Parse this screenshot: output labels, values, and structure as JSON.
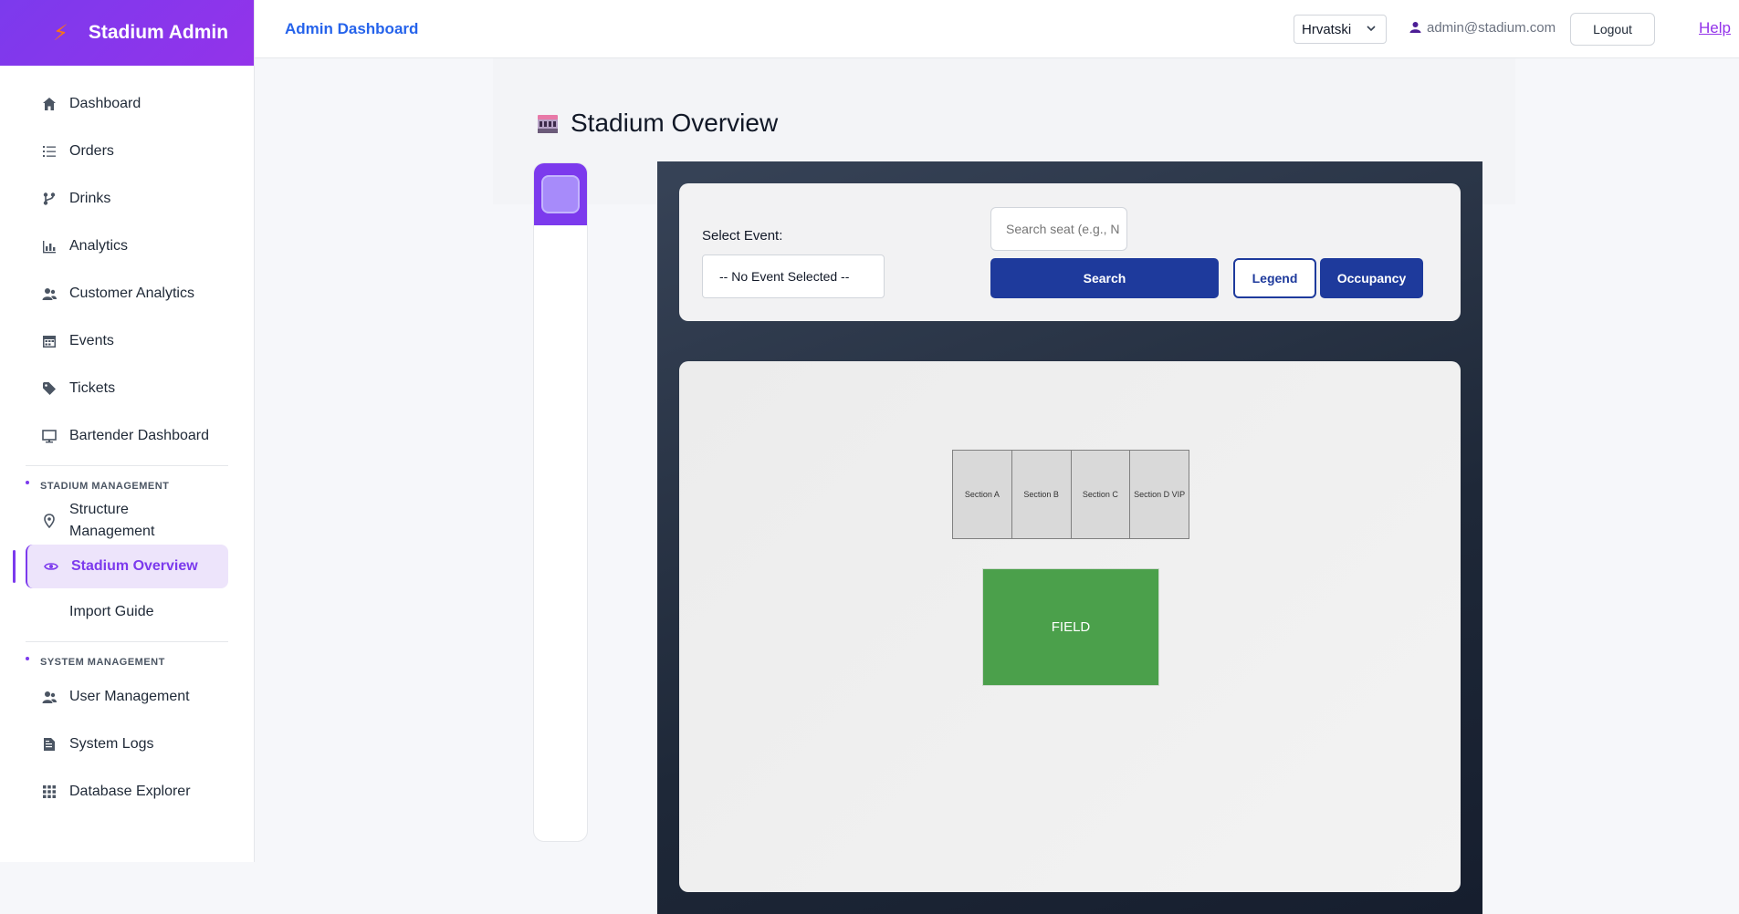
{
  "brand": {
    "title": "Stadium Admin",
    "icon": "bolt-icon"
  },
  "sidebar": {
    "items": [
      {
        "label": "Dashboard",
        "icon": "home-icon"
      },
      {
        "label": "Orders",
        "icon": "list-icon"
      },
      {
        "label": "Drinks",
        "icon": "fork-icon"
      },
      {
        "label": "Analytics",
        "icon": "bar-chart-icon"
      },
      {
        "label": "Customer Analytics",
        "icon": "users-icon"
      },
      {
        "label": "Events",
        "icon": "calendar-icon"
      },
      {
        "label": "Tickets",
        "icon": "tag-icon"
      },
      {
        "label": "Bartender Dashboard",
        "icon": "monitor-icon"
      }
    ],
    "stadium_section": {
      "header": "STADIUM MANAGEMENT",
      "items": [
        {
          "label": "Structure Management",
          "icon": "map-pin-icon"
        },
        {
          "label": "Stadium Overview",
          "icon": "eye-icon",
          "active": true
        },
        {
          "label": "Import Guide",
          "icon": ""
        }
      ]
    },
    "system_section": {
      "header": "SYSTEM MANAGEMENT",
      "items": [
        {
          "label": "User Management",
          "icon": "users-icon"
        },
        {
          "label": "System Logs",
          "icon": "log-icon"
        },
        {
          "label": "Database Explorer",
          "icon": "grid-icon"
        }
      ]
    }
  },
  "topbar": {
    "breadcrumb": "Admin Dashboard",
    "language": "Hrvatski",
    "user_email": "admin@stadium.com",
    "logout_label": "Logout",
    "help_label": "Help"
  },
  "page": {
    "title": "Stadium Overview"
  },
  "controls": {
    "select_event_label": "Select Event:",
    "selected_event": "-- No Event Selected --",
    "seat_search_placeholder": "Search seat (e.g., N",
    "search_label": "Search",
    "legend_label": "Legend",
    "occupancy_label": "Occupancy"
  },
  "map": {
    "sections": [
      "Section A",
      "Section B",
      "Section C",
      "Section D VIP"
    ],
    "field_label": "FIELD"
  },
  "colors": {
    "accent": "#7c3aed",
    "primary_button": "#1e3a9c",
    "field": "#4ba04b",
    "breadcrumb": "#2563eb"
  }
}
